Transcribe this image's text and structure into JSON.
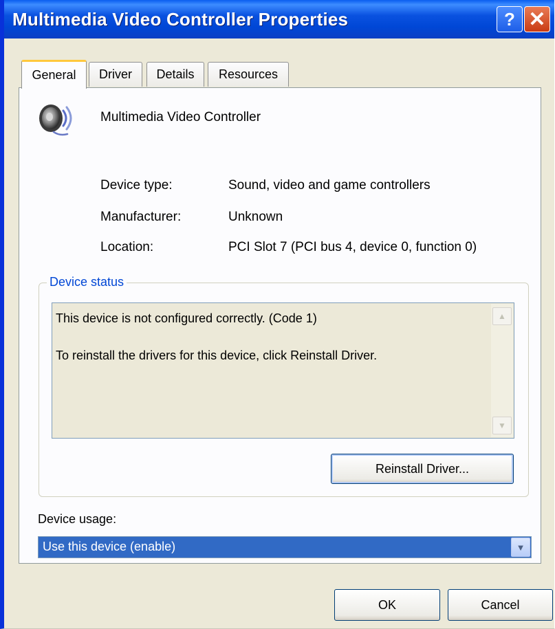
{
  "window": {
    "title": "Multimedia Video Controller Properties",
    "help_glyph": "?",
    "close_glyph": "✕"
  },
  "tabs": [
    {
      "label": "General",
      "active": true
    },
    {
      "label": "Driver",
      "active": false
    },
    {
      "label": "Details",
      "active": false
    },
    {
      "label": "Resources",
      "active": false
    }
  ],
  "device": {
    "icon": "speaker-icon",
    "name": "Multimedia Video Controller"
  },
  "properties": [
    {
      "label": "Device type:",
      "value": "Sound, video and game controllers"
    },
    {
      "label": "Manufacturer:",
      "value": "Unknown"
    },
    {
      "label": "Location:",
      "value": "PCI Slot 7 (PCI bus 4, device 0, function 0)"
    }
  ],
  "status": {
    "group_title": "Device status",
    "lines": [
      "This device is not configured correctly. (Code 1)",
      "To reinstall the drivers for this device, click Reinstall Driver."
    ],
    "reinstall_label": "Reinstall Driver..."
  },
  "usage": {
    "label": "Device usage:",
    "selected": "Use this device (enable)"
  },
  "footer": {
    "ok_label": "OK",
    "cancel_label": "Cancel"
  },
  "colors": {
    "titlebar": "#0a52e0",
    "selection": "#316ac5",
    "group_title": "#0046d5",
    "dialog_bg": "#ece9d8",
    "tab_highlight": "#ffc83c"
  }
}
